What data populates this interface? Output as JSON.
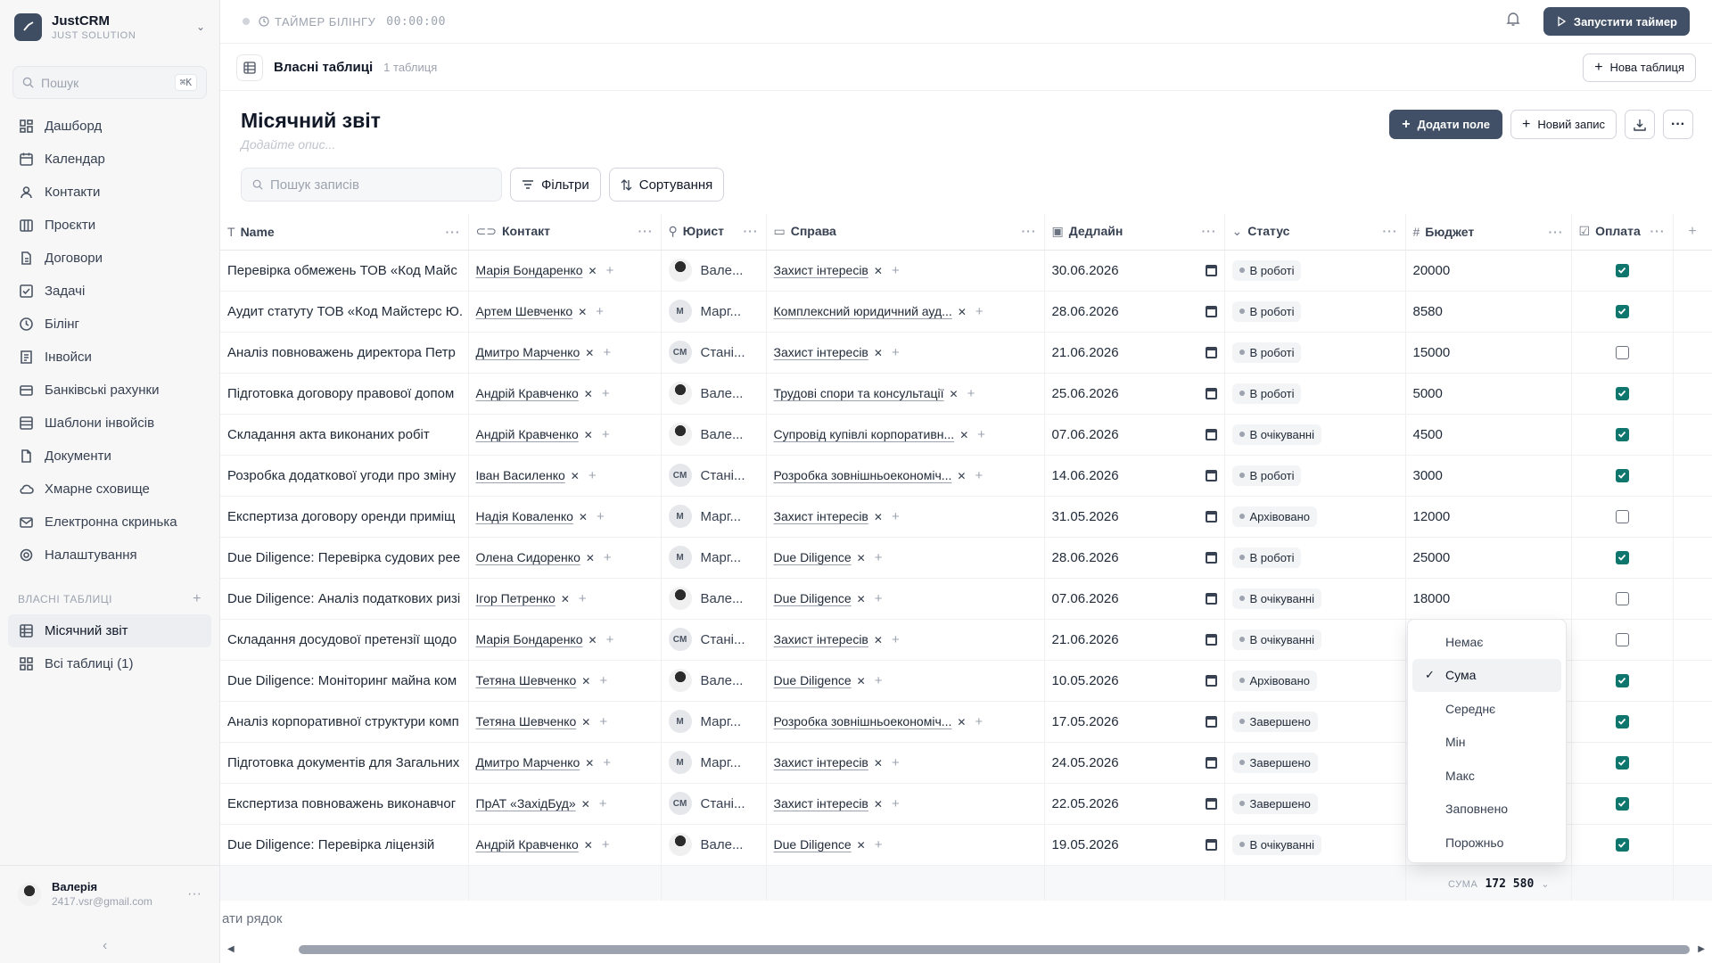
{
  "app": {
    "name": "JustCRM",
    "subtitle": "JUST SOLUTION"
  },
  "sidebar": {
    "search_placeholder": "Пошук",
    "search_shortcut": "⌘K",
    "nav": [
      {
        "label": "Дашборд",
        "icon": "dashboard-icon"
      },
      {
        "label": "Календар",
        "icon": "calendar-icon"
      },
      {
        "label": "Контакти",
        "icon": "contacts-icon"
      },
      {
        "label": "Проєкти",
        "icon": "projects-icon"
      },
      {
        "label": "Договори",
        "icon": "contracts-icon"
      },
      {
        "label": "Задачі",
        "icon": "tasks-icon"
      },
      {
        "label": "Білінг",
        "icon": "billing-icon"
      },
      {
        "label": "Інвойси",
        "icon": "invoices-icon"
      },
      {
        "label": "Банківські рахунки",
        "icon": "bank-icon"
      },
      {
        "label": "Шаблони інвойсів",
        "icon": "templates-icon"
      },
      {
        "label": "Документи",
        "icon": "documents-icon"
      },
      {
        "label": "Хмарне сховище",
        "icon": "cloud-icon"
      },
      {
        "label": "Електронна скринька",
        "icon": "mail-icon"
      },
      {
        "label": "Налаштування",
        "icon": "settings-icon"
      }
    ],
    "custom_tables_section": "ВЛАСНІ ТАБЛИЦІ",
    "custom_tables": [
      {
        "label": "Місячний звіт",
        "active": true
      },
      {
        "label": "Всі таблиці (1)",
        "active": false
      }
    ],
    "user": {
      "name": "Валерія",
      "email": "2417.vsr@gmail.com"
    }
  },
  "topbar": {
    "timer_label": "ТАЙМЕР БІЛІНГУ",
    "timer_value": "00:00:00",
    "start_timer": "Запустити таймер"
  },
  "subbar": {
    "title": "Власні таблиці",
    "count": "1 таблиця",
    "new_table": "Нова таблиця"
  },
  "page": {
    "title": "Місячний звіт",
    "description_placeholder": "Додайте опис...",
    "add_field": "Додати поле",
    "new_record": "Новий запис",
    "search_placeholder": "Пошук записів",
    "filters": "Фільтри",
    "sort": "Сортування",
    "add_row": "ати рядок"
  },
  "columns": [
    "Name",
    "Контакт",
    "Юрист",
    "Справа",
    "Дедлайн",
    "Статус",
    "Бюджет",
    "Оплата"
  ],
  "rows": [
    {
      "name": "Перевірка обмежень ТОВ «Код Майс",
      "contact": "Марія Бондаренко",
      "lawyer": "Вале...",
      "lawyer_avatar": "photo",
      "case": "Захист інтересів",
      "deadline": "30.06.2026",
      "status": "В роботі",
      "budget": "20000",
      "paid": true
    },
    {
      "name": "Аудит статуту ТОВ «Код Майстерс Ю.",
      "contact": "Артем Шевченко",
      "lawyer": "Марг...",
      "lawyer_avatar": "M",
      "case": "Комплексний юридичний ауд...",
      "deadline": "28.06.2026",
      "status": "В роботі",
      "budget": "8580",
      "paid": true
    },
    {
      "name": "Аналіз повноважень директора Петр",
      "contact": "Дмитро Марченко",
      "lawyer": "Стані...",
      "lawyer_avatar": "CM",
      "case": "Захист інтересів",
      "deadline": "21.06.2026",
      "status": "В роботі",
      "budget": "15000",
      "paid": false
    },
    {
      "name": "Підготовка договору правової допом",
      "contact": "Андрій Кравченко",
      "lawyer": "Вале...",
      "lawyer_avatar": "photo",
      "case": "Трудові спори та консультації",
      "deadline": "25.06.2026",
      "status": "В роботі",
      "budget": "5000",
      "paid": true
    },
    {
      "name": "Складання акта виконаних робіт",
      "contact": "Андрій Кравченко",
      "lawyer": "Вале...",
      "lawyer_avatar": "photo",
      "case": "Супровід купівлі корпоративн...",
      "deadline": "07.06.2026",
      "status": "В очікуванні",
      "budget": "4500",
      "paid": true
    },
    {
      "name": "Розробка додаткової угоди про зміну",
      "contact": "Іван Василенко",
      "lawyer": "Стані...",
      "lawyer_avatar": "CM",
      "case": "Розробка зовнішньоекономіч...",
      "deadline": "14.06.2026",
      "status": "В роботі",
      "budget": "3000",
      "paid": true
    },
    {
      "name": "Експертиза договору оренди приміщ",
      "contact": "Надія Коваленко",
      "lawyer": "Марг...",
      "lawyer_avatar": "M",
      "case": "Захист інтересів",
      "deadline": "31.05.2026",
      "status": "Архівовано",
      "budget": "12000",
      "paid": false
    },
    {
      "name": "Due Diligence: Перевірка судових рее",
      "contact": "Олена Сидоренко",
      "lawyer": "Марг...",
      "lawyer_avatar": "M",
      "case": "Due Diligence",
      "deadline": "28.06.2026",
      "status": "В роботі",
      "budget": "25000",
      "paid": true
    },
    {
      "name": "Due Diligence: Аналіз податкових ризі",
      "contact": "Ігор Петренко",
      "lawyer": "Вале...",
      "lawyer_avatar": "photo",
      "case": "Due Diligence",
      "deadline": "07.06.2026",
      "status": "В очікуванні",
      "budget": "18000",
      "paid": false
    },
    {
      "name": "Складання досудової претензії щодо",
      "contact": "Марія Бондаренко",
      "lawyer": "Стані...",
      "lawyer_avatar": "CM",
      "case": "Захист інтересів",
      "deadline": "21.06.2026",
      "status": "В очікуванні",
      "budget": "",
      "paid": false
    },
    {
      "name": "Due Diligence: Моніторинг майна ком",
      "contact": "Тетяна Шевченко",
      "lawyer": "Вале...",
      "lawyer_avatar": "photo",
      "case": "Due Diligence",
      "deadline": "10.05.2026",
      "status": "Архівовано",
      "budget": "",
      "paid": true
    },
    {
      "name": "Аналіз корпоративної структури комп",
      "contact": "Тетяна Шевченко",
      "lawyer": "Марг...",
      "lawyer_avatar": "M",
      "case": "Розробка зовнішньоекономіч...",
      "deadline": "17.05.2026",
      "status": "Завершено",
      "budget": "",
      "paid": true
    },
    {
      "name": "Підготовка документів для Загальних",
      "contact": "Дмитро Марченко",
      "lawyer": "Марг...",
      "lawyer_avatar": "M",
      "case": "Захист інтересів",
      "deadline": "24.05.2026",
      "status": "Завершено",
      "budget": "",
      "paid": true
    },
    {
      "name": "Експертиза повноважень виконавчог",
      "contact": "ПрАТ «ЗахідБуд»",
      "lawyer": "Стані...",
      "lawyer_avatar": "CM",
      "case": "Захист інтересів",
      "deadline": "22.05.2026",
      "status": "Завершено",
      "budget": "",
      "paid": true
    },
    {
      "name": "Due Diligence: Перевірка ліцензій",
      "contact": "Андрій Кравченко",
      "lawyer": "Вале...",
      "lawyer_avatar": "photo",
      "case": "Due Diligence",
      "deadline": "19.05.2026",
      "status": "В очікуванні",
      "budget": "",
      "paid": true
    }
  ],
  "summary": {
    "label": "СУМА",
    "value": "172 580"
  },
  "aggregate_menu": {
    "options": [
      "Немає",
      "Сума",
      "Середнє",
      "Мін",
      "Макс",
      "Заповнено",
      "Порожньо"
    ],
    "selected": "Сума"
  }
}
